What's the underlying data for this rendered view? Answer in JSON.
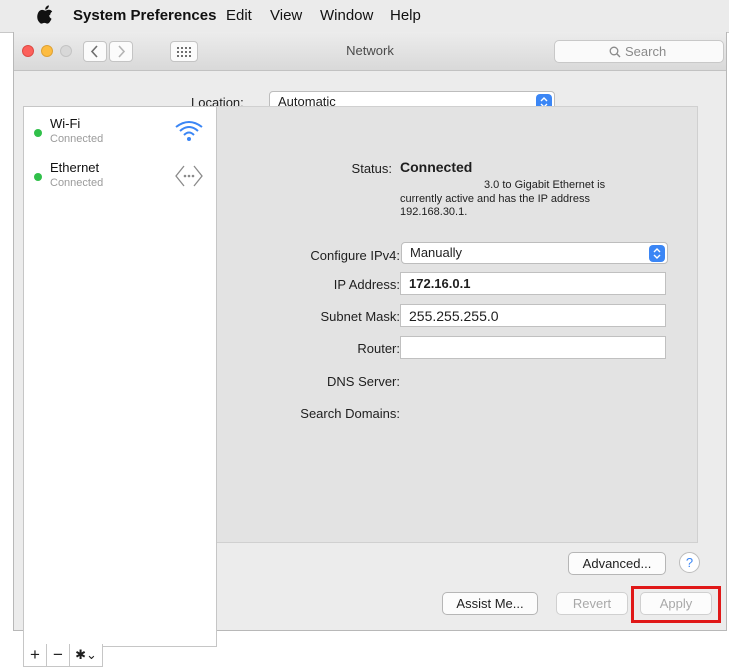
{
  "menubar": {
    "app": "System Preferences",
    "items": [
      "Edit",
      "View",
      "Window",
      "Help"
    ]
  },
  "window": {
    "title": "Network",
    "search_placeholder": "Search"
  },
  "location": {
    "label": "Location:",
    "value": "Automatic"
  },
  "services": [
    {
      "name": "Wi-Fi",
      "status": "Connected",
      "icon": "wifi-icon"
    },
    {
      "name": "Ethernet",
      "status": "Connected",
      "icon": "ethernet-icon"
    }
  ],
  "sidebar_bar": {
    "add": "+",
    "remove": "−",
    "action": "✱⌄"
  },
  "detail": {
    "status_label": "Status:",
    "status_value": "Connected",
    "status_desc_line1": "3.0 to Gigabit Ethernet is",
    "status_desc_line2": "currently active and has the IP address",
    "status_desc_line3": "192.168.30.1.",
    "configure_label": "Configure IPv4:",
    "configure_value": "Manually",
    "ip_label": "IP Address:",
    "ip_value": "172.16.0.1",
    "subnet_label": "Subnet Mask:",
    "subnet_value": "255.255.255.0",
    "router_label": "Router:",
    "router_value": "",
    "dns_label": "DNS Server:",
    "search_domains_label": "Search Domains:"
  },
  "buttons": {
    "advanced": "Advanced...",
    "help": "?",
    "assist": "Assist Me...",
    "revert": "Revert",
    "apply": "Apply"
  },
  "colors": {
    "status_green": "#30c04a",
    "accent_blue": "#3b86f5",
    "highlight_red": "#e01818"
  }
}
